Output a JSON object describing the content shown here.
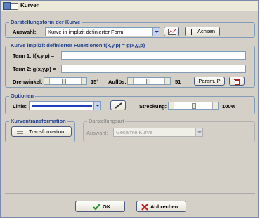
{
  "window": {
    "title": "Kurven"
  },
  "darstellung": {
    "group_label": "Darstellungsform der Kurve",
    "auswahl_label": "Auswahl:",
    "auswahl_value": "Kurve in implizit definierter Form",
    "achsen_label": "Achsen"
  },
  "funktionen": {
    "group_label": "Kurve implizit definierter Funktionen f(x,y,p) = g(x,y,p)",
    "term1_label": "Term 1: f(x,y,p) =",
    "term1_value": "",
    "term2_label": "Term 2: g(x,y,p) =",
    "term2_value": "",
    "drehwinkel_label": "Drehwinkel:",
    "drehwinkel_value": "15°",
    "aufloes_label": "Auflös:",
    "aufloes_value": "51",
    "param_label": "Param. P"
  },
  "optionen": {
    "group_label": "Optionen",
    "linie_label": "Linie:",
    "streckung_label": "Streckung:",
    "streckung_value": "100%"
  },
  "kurventransformation": {
    "group_label": "Kurventransformation",
    "transformation_label": "Transformation"
  },
  "darstellungsart": {
    "group_label": "Darstellungsart",
    "auswahl_label": "Auswahl:",
    "auswahl_value": "Gesamte Kurve"
  },
  "footer": {
    "ok_label": "OK",
    "abbrechen_label": "Abbrechen"
  },
  "colors": {
    "accent": "#1f3f8f",
    "window_bg": "#d4d0c8",
    "line_color": "#1f3fbf"
  }
}
